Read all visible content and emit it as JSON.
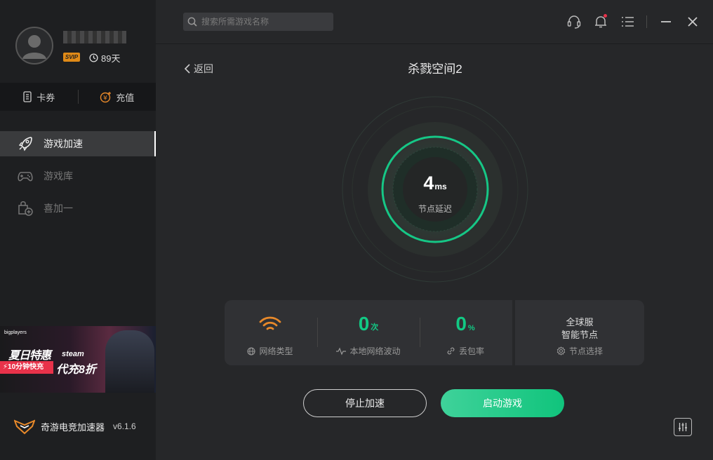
{
  "user": {
    "vip_badge": "SVIP",
    "days_left": "89天"
  },
  "wallet": {
    "coupon_label": "卡券",
    "recharge_label": "充值"
  },
  "nav": {
    "items": [
      {
        "label": "游戏加速"
      },
      {
        "label": "游戏库"
      },
      {
        "label": "喜加一"
      }
    ]
  },
  "banner": {
    "brand": "bigplayers",
    "headline": "夏日特惠",
    "steam": "steam",
    "discount": "代充8折",
    "tag": "⚡10分钟快充"
  },
  "footer": {
    "app_name": "奇游电竞加速器",
    "version": "v6.1.6"
  },
  "search": {
    "placeholder": "搜索所需游戏名称"
  },
  "header": {
    "back_label": "返回",
    "game_title": "杀戮空间2"
  },
  "ping": {
    "value": "4",
    "unit": "ms",
    "label": "节点延迟"
  },
  "stats": {
    "network_type_label": "网络类型",
    "fluctuation_value": "0",
    "fluctuation_unit": "次",
    "fluctuation_label": "本地网络波动",
    "loss_value": "0",
    "loss_unit": "%",
    "loss_label": "丢包率"
  },
  "node": {
    "line1": "全球服",
    "line2": "智能节点",
    "select_label": "节点选择"
  },
  "actions": {
    "stop_label": "停止加速",
    "start_label": "启动游戏"
  },
  "colors": {
    "accent": "#12c984",
    "wifi": "#e8892a",
    "alert": "#e8324a"
  }
}
